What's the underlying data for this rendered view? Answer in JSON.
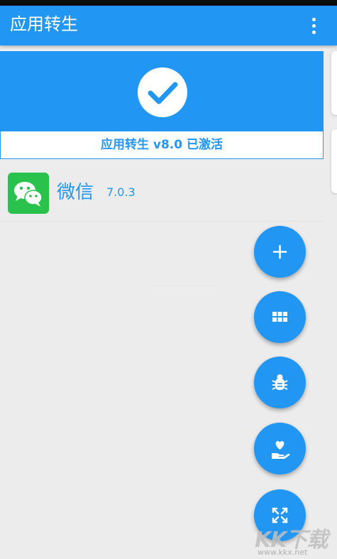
{
  "app_bar": {
    "title": "应用转生",
    "menu_icon": "more-vertical-icon"
  },
  "activation": {
    "status_icon": "check-circle-icon",
    "text": "应用转生 v8.0 已激活"
  },
  "app_list": [
    {
      "name": "微信",
      "version": "7.0.3",
      "icon": "wechat-icon"
    }
  ],
  "fabs": [
    {
      "name": "add-fab",
      "icon": "plus-icon"
    },
    {
      "name": "grid-fab",
      "icon": "grid-icon"
    },
    {
      "name": "debug-fab",
      "icon": "bug-icon"
    },
    {
      "name": "donate-fab",
      "icon": "hand-heart-icon"
    },
    {
      "name": "expand-fab",
      "icon": "expand-icon"
    }
  ],
  "watermark": {
    "logo_text": "KK下载",
    "url": "www.kkx.net"
  },
  "colors": {
    "primary": "#2196f3",
    "background": "#ececec",
    "wechat_green": "#29c24d"
  }
}
